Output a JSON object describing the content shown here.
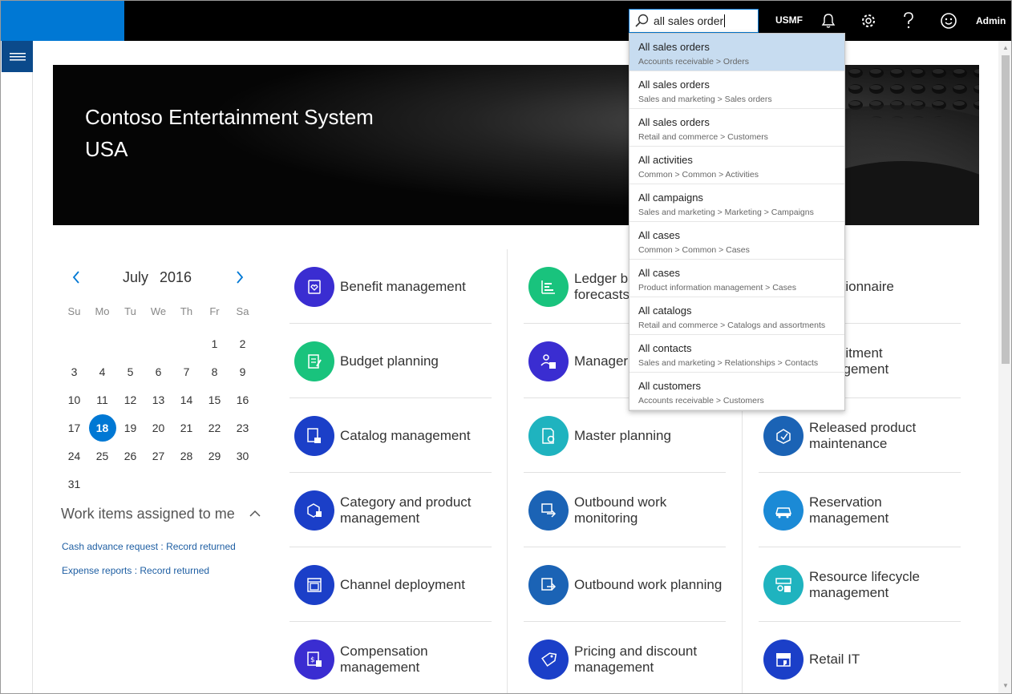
{
  "topbar": {
    "search_value": "all sales order",
    "company": "USMF",
    "user": "Admin",
    "accent": "#0078d4"
  },
  "banner": {
    "title_line1": "Contoso Entertainment System",
    "title_line2": "USA"
  },
  "calendar": {
    "month": "July",
    "year": "2016",
    "weekdays": [
      "Su",
      "Mo",
      "Tu",
      "We",
      "Th",
      "Fr",
      "Sa"
    ],
    "weeks": [
      [
        "",
        "",
        "",
        "",
        "",
        "1",
        "2"
      ],
      [
        "3",
        "4",
        "5",
        "6",
        "7",
        "8",
        "9"
      ],
      [
        "10",
        "11",
        "12",
        "13",
        "14",
        "15",
        "16"
      ],
      [
        "17",
        "18",
        "19",
        "20",
        "21",
        "22",
        "23"
      ],
      [
        "24",
        "25",
        "26",
        "27",
        "28",
        "29",
        "30"
      ],
      [
        "31",
        "",
        "",
        "",
        "",
        "",
        ""
      ]
    ],
    "today": "18"
  },
  "work_items": {
    "title": "Work items assigned to me",
    "links": [
      "Cash advance request : Record returned",
      "Expense reports : Record returned"
    ]
  },
  "tiles": {
    "col1": [
      {
        "label": "Benefit management",
        "color": "#3a2dd1",
        "icon": "benefit-icon"
      },
      {
        "label": "Budget planning",
        "color": "#19c37d",
        "icon": "budget-icon"
      },
      {
        "label": "Catalog management",
        "color": "#1b3fc8",
        "icon": "catalog-icon"
      },
      {
        "label": "Category and product management",
        "color": "#1b3fc8",
        "icon": "category-icon"
      },
      {
        "label": "Channel deployment",
        "color": "#1b3fc8",
        "icon": "channel-icon"
      },
      {
        "label": "Compensation management",
        "color": "#3a2dd1",
        "icon": "compensation-icon"
      }
    ],
    "col2": [
      {
        "label": "Ledger budgets and forecasts",
        "color": "#19c37d",
        "icon": "ledger-icon"
      },
      {
        "label": "Manager self-service",
        "color": "#3a2dd1",
        "icon": "manager-icon"
      },
      {
        "label": "Master planning",
        "color": "#1fb3bf",
        "icon": "planning-icon"
      },
      {
        "label": "Outbound work monitoring",
        "color": "#1b63b5",
        "icon": "outbound-monitor-icon"
      },
      {
        "label": "Outbound work planning",
        "color": "#1b63b5",
        "icon": "outbound-plan-icon"
      },
      {
        "label": "Pricing and discount management",
        "color": "#1b3fc8",
        "icon": "pricing-icon"
      }
    ],
    "col3": [
      {
        "label": "Questionnaire",
        "color": "#3a2dd1",
        "icon": "questionnaire-icon"
      },
      {
        "label": "Recruitment management",
        "color": "#3a2dd1",
        "icon": "recruitment-icon"
      },
      {
        "label": "Released product maintenance",
        "color": "#1b63b5",
        "icon": "released-product-icon"
      },
      {
        "label": "Reservation management",
        "color": "#1b8ad6",
        "icon": "reservation-icon"
      },
      {
        "label": "Resource lifecycle management",
        "color": "#1fb3bf",
        "icon": "resource-icon"
      },
      {
        "label": "Retail IT",
        "color": "#1b3fc8",
        "icon": "retail-it-icon"
      }
    ]
  },
  "dropdown": {
    "items": [
      {
        "title": "All sales orders",
        "path": "Accounts receivable > Orders"
      },
      {
        "title": "All sales orders",
        "path": "Sales and marketing > Sales orders"
      },
      {
        "title": "All sales orders",
        "path": "Retail and commerce > Customers"
      },
      {
        "title": "All activities",
        "path": "Common > Common > Activities"
      },
      {
        "title": "All campaigns",
        "path": "Sales and marketing > Marketing > Campaigns"
      },
      {
        "title": "All cases",
        "path": "Common > Common > Cases"
      },
      {
        "title": "All cases",
        "path": "Product information management > Cases"
      },
      {
        "title": "All catalogs",
        "path": "Retail and commerce > Catalogs and assortments"
      },
      {
        "title": "All contacts",
        "path": "Sales and marketing > Relationships > Contacts"
      },
      {
        "title": "All customers",
        "path": "Accounts receivable > Customers"
      }
    ]
  }
}
